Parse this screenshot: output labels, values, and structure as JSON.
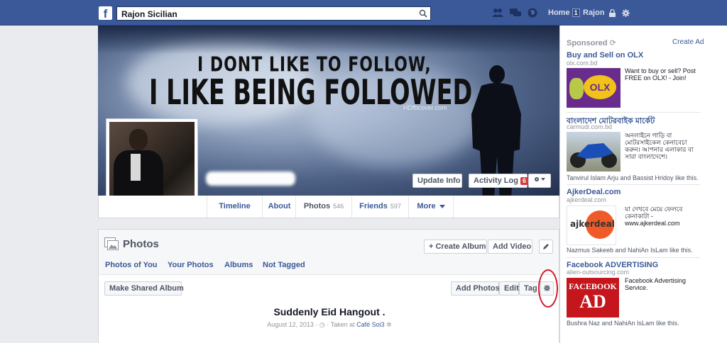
{
  "topbar": {
    "logo": "f",
    "search_value": "Rajon Sicilian",
    "home_label": "Home",
    "home_count": "1",
    "user_name": "Rajon"
  },
  "cover": {
    "line1": "I DONT LIKE TO FOLLOW,",
    "line2": "I LIKE BEING FOLLOWED",
    "watermark": "HDfbcover.com"
  },
  "profile_actions": {
    "update_info": "Update Info",
    "activity_log": "Activity Log",
    "activity_count": "6"
  },
  "tabs": [
    {
      "label": "Timeline",
      "count": ""
    },
    {
      "label": "About",
      "count": ""
    },
    {
      "label": "Photos",
      "count": "546"
    },
    {
      "label": "Friends",
      "count": "597"
    },
    {
      "label": "More",
      "count": ""
    }
  ],
  "photos": {
    "title": "Photos",
    "create_album": "+ Create Album",
    "add_video": "Add Video",
    "subtabs": [
      "Photos of You",
      "Your Photos",
      "Albums",
      "Not Tagged"
    ],
    "make_shared_album": "Make Shared Album",
    "add_photos": "Add Photos",
    "edit": "Edit",
    "tag": "Tag",
    "album_title": "Suddenly Eid Hangout .",
    "album_date": "August 12, 2013 ·",
    "album_taken": "· Taken at",
    "album_place": "Café Soi3"
  },
  "sidebar": {
    "sponsored": "Sponsored",
    "create_ad": "Create Ad",
    "ads": [
      {
        "title": "Buy and Sell on OLX",
        "url": "olx.com.bd",
        "desc": "Want to buy or sell? Post FREE on OLX! - Join!",
        "social": ""
      },
      {
        "title": "বাংলাদেশ মোটরবাইক মার্কেট",
        "url": "carmudi.com.bd",
        "desc": "অনলাইনে গাড়ি বা মোটরসাইকেল কেনাবেচা করুন। আপনার এলাকার বা সারা বাংলাদেশে।",
        "social": "Tanvirul Islam Arju and Bassist Hridoy like this."
      },
      {
        "title": "AjkerDeal.com",
        "url": "ajkerdeal.com",
        "desc": "যা দেখবে মেয়ে ফেলবে কেনাকাটা - www.ajkerdeal.com",
        "social": "Nazmus Sakeeb and NahiAn IsLam like this."
      },
      {
        "title": "Facebook ADVERTISING",
        "url": "alien-outsourcing.com",
        "desc": "Facebook Advertising Service.",
        "social": "Bushra Naz and NahiAn IsLam like this."
      }
    ],
    "olx_logo": "OLX",
    "ajker_logo": "ajkerdeal",
    "fbad_line1": "FACEBOOK",
    "fbad_line2": "AD"
  },
  "colors": {
    "brand": "#3b5998",
    "annotation": "#d11a2a",
    "badge": "#d63b3b"
  }
}
